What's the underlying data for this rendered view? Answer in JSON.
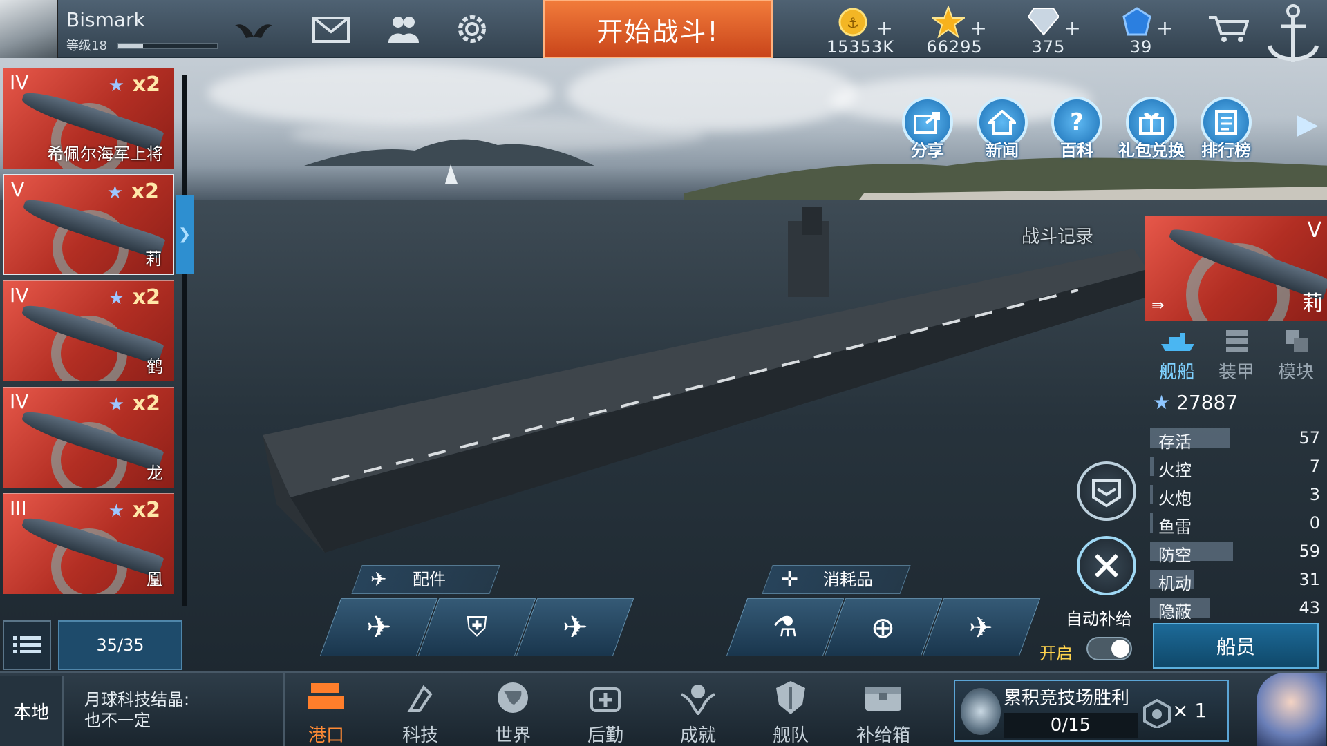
{
  "player": {
    "name": "Bismark",
    "level": "等级18",
    "xp_fraction": 0.25
  },
  "start_battle": "开始战斗!",
  "resources": [
    {
      "icon": "gold-coin-icon",
      "value": "15353K"
    },
    {
      "icon": "star-icon",
      "value": "66295"
    },
    {
      "icon": "diamond-icon",
      "value": "375"
    },
    {
      "icon": "blue-gem-icon",
      "value": "39"
    }
  ],
  "shortcuts": [
    {
      "key": "share",
      "label": "分享"
    },
    {
      "key": "news",
      "label": "新闻"
    },
    {
      "key": "wiki",
      "label": "百科"
    },
    {
      "key": "gift-redeem",
      "label": "礼包兑换"
    },
    {
      "key": "ranking",
      "label": "排行榜"
    }
  ],
  "ship_list": [
    {
      "tier": "IV",
      "multiplier": "x2",
      "name": "希佩尔海军上将",
      "selected": false
    },
    {
      "tier": "V",
      "multiplier": "x2",
      "name": "莉",
      "selected": true
    },
    {
      "tier": "IV",
      "multiplier": "x2",
      "name": "鹤",
      "selected": false
    },
    {
      "tier": "IV",
      "multiplier": "x2",
      "name": "龙",
      "selected": false
    },
    {
      "tier": "III",
      "multiplier": "x2",
      "name": "凰",
      "selected": false
    }
  ],
  "ship_count": "35/35",
  "battle_record": "战斗记录",
  "selected_ship": {
    "tier": "V",
    "name": "莉",
    "power": "27887"
  },
  "right_tabs": [
    {
      "key": "ship",
      "label": "舰船",
      "active": true
    },
    {
      "key": "armor",
      "label": "装甲",
      "active": false
    },
    {
      "key": "module",
      "label": "模块",
      "active": false
    }
  ],
  "stats": [
    {
      "label": "存活",
      "value": "57",
      "fill": 0.45
    },
    {
      "label": "火控",
      "value": "7",
      "fill": 0.02
    },
    {
      "label": "火炮",
      "value": "3",
      "fill": 0.01
    },
    {
      "label": "鱼雷",
      "value": "0",
      "fill": 0.0
    },
    {
      "label": "防空",
      "value": "59",
      "fill": 0.47
    },
    {
      "label": "机动",
      "value": "31",
      "fill": 0.25
    },
    {
      "label": "隐蔽",
      "value": "43",
      "fill": 0.34
    }
  ],
  "crew_button": "船员",
  "auto_supply": {
    "label": "自动补给",
    "state_label": "开启",
    "on": true
  },
  "parts": {
    "header": "配件"
  },
  "consumables": {
    "header": "消耗品"
  },
  "local_button": "本地",
  "news_ticker": [
    "月球科技结晶:",
    "也不一定"
  ],
  "nav": [
    {
      "key": "port",
      "label": "港口",
      "active": true
    },
    {
      "key": "tech",
      "label": "科技",
      "active": false
    },
    {
      "key": "world",
      "label": "世界",
      "active": false
    },
    {
      "key": "logistics",
      "label": "后勤",
      "active": false
    },
    {
      "key": "achievements",
      "label": "成就",
      "active": false
    },
    {
      "key": "fleet",
      "label": "舰队",
      "active": false
    },
    {
      "key": "supply-box",
      "label": "补给箱",
      "active": false
    }
  ],
  "arena": {
    "title": "累积竞技场胜利",
    "progress": "0/15",
    "reward_multiplier": "× 1"
  }
}
